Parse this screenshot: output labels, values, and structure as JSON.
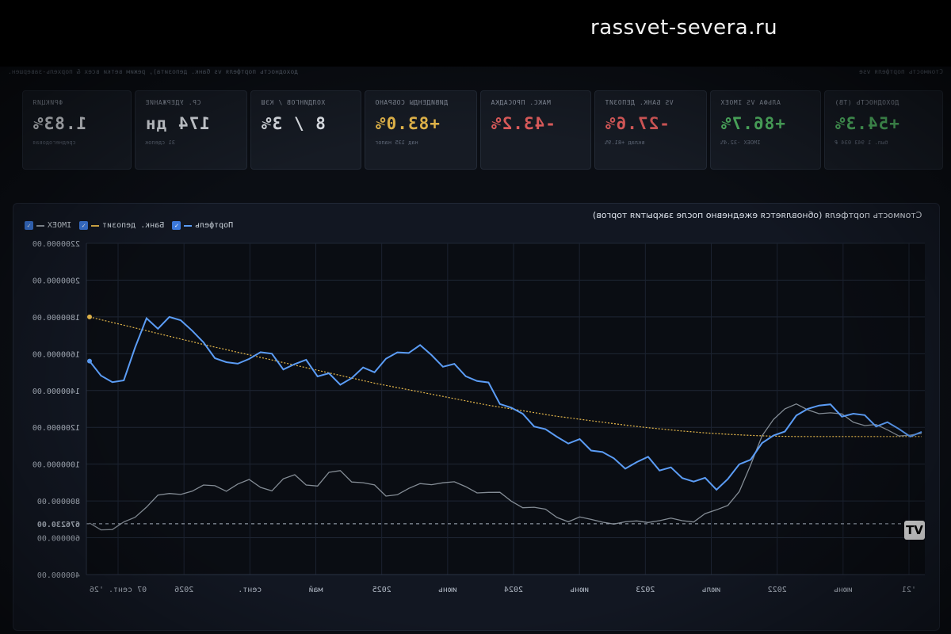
{
  "watermark": "rassvet-severa.ru",
  "topline": {
    "left": "доходность портфеля vs банк. депозита), режим ветки всех & порхель-завершен.",
    "right": "Стоимость портфеля vse"
  },
  "cards": [
    {
      "label": "Доходность (ТВ)",
      "value": "+54.3%",
      "sub": "был. 1 943 034 ₽",
      "color": "#57c26b"
    },
    {
      "label": "Альфа vs IMOEX",
      "value": "+86.7%",
      "sub": "IMOEX -32.4%",
      "color": "#57c26b"
    },
    {
      "label": "vs банк. депозит",
      "value": "-27.6%",
      "sub": "вклад +81.9%",
      "color": "#e05d5d"
    },
    {
      "label": "макс. просадка",
      "value": "-43.2%",
      "sub": "",
      "color": "#e05d5d"
    },
    {
      "label": "дивиденды собрано",
      "value": "+83.0%",
      "sub": "над 135 налог",
      "color": "#e6b84b"
    },
    {
      "label": "холдингов / кэш",
      "value": "8 / 3%",
      "sub": "",
      "color": "#e8ecf2"
    },
    {
      "label": "ср. удержание",
      "value": "174 дн",
      "sub": "31 сделок",
      "color": "#e8ecf2"
    },
    {
      "label": "фрикция",
      "value": "1.83%",
      "sub": "среднегодовая",
      "color": "#e8ecf2"
    }
  ],
  "panel": {
    "title": "Стоимость портфеля (обновляется ежедневно после закрытия торгов)",
    "legend": [
      {
        "label": "IMOEX",
        "color": "#9aa3ad"
      },
      {
        "label": "Банк. депозит",
        "color": "#e6b84b"
      },
      {
        "label": "Портфель",
        "color": "#5b9cf5"
      }
    ]
  },
  "chart_data": {
    "type": "line",
    "title": "Стоимость портфеля (обновляется ежедневно после закрытия торгов)",
    "mirrored": true,
    "y_ticks": [
      "2200000.00",
      "2000000.00",
      "1800000.00",
      "1600000.00",
      "1400000.00",
      "1200000.00",
      "1000000.00",
      "800000.00",
      "676230.00",
      "600000.00",
      "400000.00"
    ],
    "ylim": [
      400000,
      2200000
    ],
    "baseline": 676230,
    "x_ticks": [
      "07 сент. '26",
      "2026",
      "сент.",
      "май",
      "2025",
      "июнь",
      "2024",
      "июнь",
      "2023",
      "июль",
      "2022",
      "июнь",
      "'21"
    ],
    "series": [
      {
        "name": "Портфель",
        "color": "#5b9cf5",
        "values": [
          1560000,
          1500000,
          1420000,
          1470000,
          1640000,
          1770000,
          1760000,
          1790000,
          1770000,
          1750000,
          1640000,
          1580000,
          1570000,
          1520000,
          1590000,
          1610000,
          1580000,
          1540000,
          1530000,
          1560000,
          1500000,
          1470000,
          1440000,
          1480000,
          1500000,
          1520000,
          1570000,
          1590000,
          1630000,
          1630000,
          1590000,
          1550000,
          1520000,
          1490000,
          1460000,
          1420000,
          1350000,
          1300000,
          1260000,
          1230000,
          1170000,
          1150000,
          1130000,
          1110000,
          1090000,
          1070000,
          1010000,
          1000000,
          1000000,
          1030000,
          990000,
          960000,
          930000,
          920000,
          900000,
          880000,
          920000,
          980000,
          1050000,
          1100000,
          1150000,
          1200000,
          1240000,
          1310000,
          1330000,
          1300000,
          1280000,
          1270000,
          1250000,
          1230000,
          1210000,
          1190000,
          1170000,
          1150000
        ]
      },
      {
        "name": "Банк. депозит",
        "color": "#e6b84b",
        "values": [
          1800000,
          1785000,
          1770000,
          1755000,
          1740000,
          1725000,
          1710000,
          1695000,
          1680000,
          1665000,
          1650000,
          1636000,
          1622000,
          1608000,
          1594000,
          1580000,
          1566000,
          1552000,
          1538000,
          1524000,
          1510000,
          1496000,
          1482000,
          1468000,
          1454000,
          1440000,
          1428000,
          1416000,
          1404000,
          1392000,
          1380000,
          1368000,
          1356000,
          1344000,
          1332000,
          1320000,
          1310000,
          1300000,
          1290000,
          1280000,
          1270000,
          1260000,
          1252000,
          1244000,
          1236000,
          1228000,
          1220000,
          1212000,
          1205000,
          1198000,
          1192000,
          1186000,
          1180000,
          1175000,
          1170000,
          1166000,
          1162000,
          1159000,
          1156000,
          1154000,
          1152000,
          1151000,
          1150000,
          1150000,
          1150000,
          1150000,
          1150000,
          1150000,
          1150000,
          1150000,
          1150000,
          1150000,
          1150000,
          1150000
        ]
      },
      {
        "name": "IMOEX",
        "color": "#9aa3ad",
        "values": [
          680000,
          660000,
          640000,
          670000,
          720000,
          780000,
          820000,
          830000,
          850000,
          860000,
          870000,
          880000,
          870000,
          890000,
          900000,
          880000,
          870000,
          910000,
          930000,
          900000,
          890000,
          940000,
          960000,
          920000,
          900000,
          870000,
          830000,
          850000,
          860000,
          880000,
          900000,
          910000,
          890000,
          870000,
          860000,
          850000,
          830000,
          800000,
          780000,
          760000,
          740000,
          720000,
          700000,
          700000,
          690000,
          700000,
          680000,
          670000,
          690000,
          700000,
          690000,
          690000,
          700000,
          700000,
          720000,
          740000,
          790000,
          860000,
          980000,
          1150000,
          1260000,
          1300000,
          1310000,
          1300000,
          1290000,
          1270000,
          1260000,
          1240000,
          1220000,
          1200000,
          1180000,
          1170000,
          1160000,
          1150000
        ]
      }
    ]
  }
}
